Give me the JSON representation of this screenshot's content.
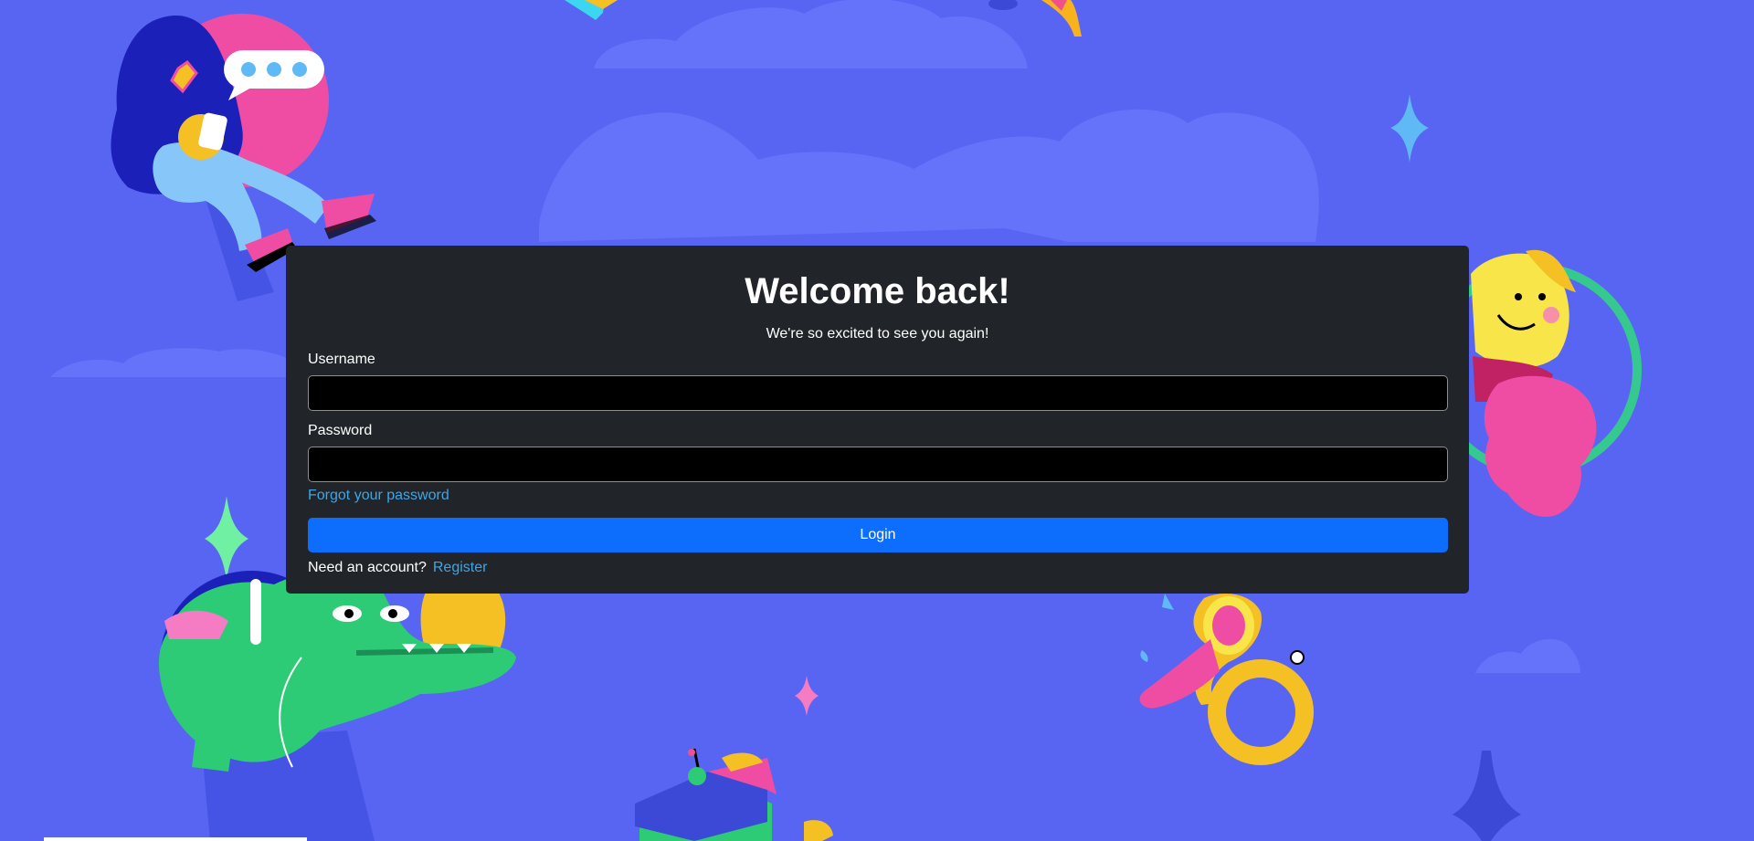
{
  "theme": {
    "background": "#5865f2",
    "card": "#212529",
    "accent": "#0d6efd",
    "link": "#3ea6e8"
  },
  "login": {
    "title": "Welcome back!",
    "subtitle": "We're so excited to see you again!",
    "username_label": "Username",
    "username_value": "",
    "password_label": "Password",
    "password_value": "",
    "forgot_label": "Forgot your password",
    "login_label": "Login",
    "need_account_text": "Need an account?",
    "register_label": "Register"
  },
  "decorations": {
    "icons": [
      "girl-with-phone-illustration",
      "speech-bubble-icon",
      "cloud-icon",
      "sparkle-icon",
      "crocodile-with-headphones-illustration",
      "yellow-creature-illustration",
      "french-horn-illustration",
      "radio-sandwich-illustration",
      "star-icon"
    ]
  }
}
